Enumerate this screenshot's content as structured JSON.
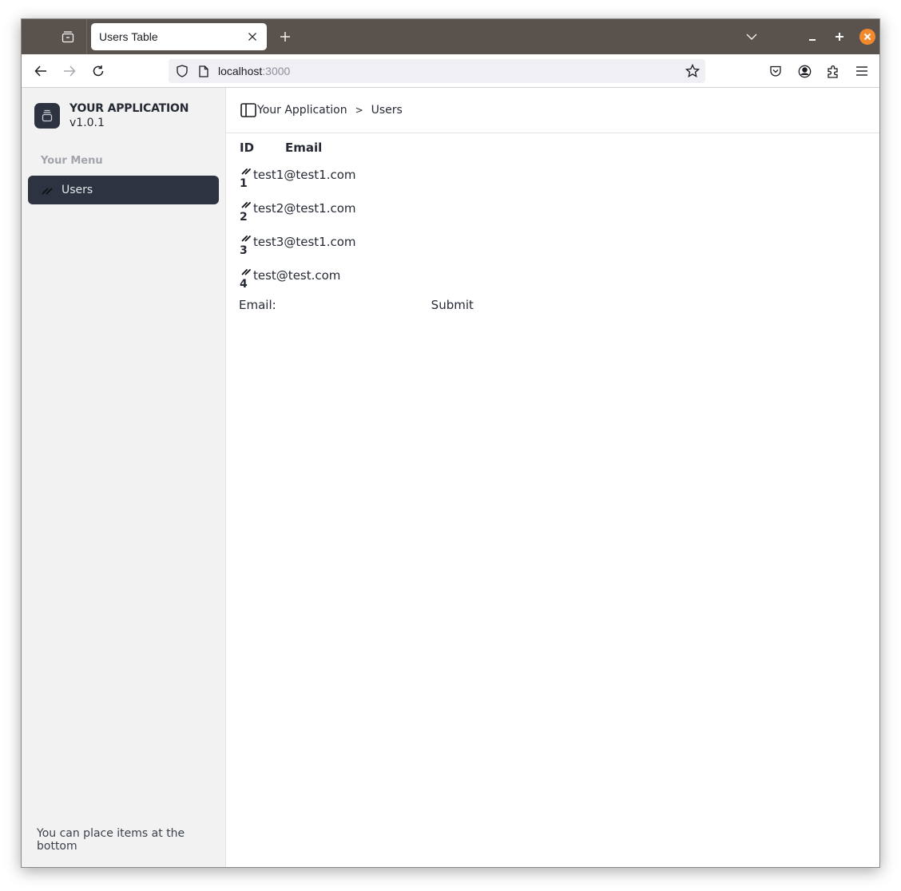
{
  "browser": {
    "tab": {
      "title": "Users Table"
    },
    "url": {
      "host": "localhost",
      "port": ":3000"
    },
    "icons": {
      "tab_list": "tab-list-icon",
      "close_tab": "close-icon",
      "new_tab": "plus-icon",
      "tabs_dropdown": "chevron-down-icon",
      "back": "arrow-left-icon",
      "forward": "arrow-right-icon",
      "reload": "reload-icon",
      "shield": "shield-icon",
      "page": "page-icon",
      "bookmark": "star-icon",
      "pocket": "pocket-icon",
      "account": "account-icon",
      "extensions": "puzzle-icon",
      "menu": "hamburger-icon"
    },
    "accent_close": "#f08a2c"
  },
  "sidebar": {
    "brand": {
      "name": "YOUR APPLICATION",
      "version": "v1.0.1"
    },
    "menu_label": "Your Menu",
    "items": [
      {
        "label": "Users",
        "icon": "slashes-icon",
        "active": true
      }
    ],
    "footer": "You can place items at the bottom"
  },
  "header": {
    "breadcrumb": [
      {
        "label": "Your Application"
      },
      {
        "label": "Users"
      }
    ],
    "separator": ">"
  },
  "table": {
    "columns": [
      "ID",
      "Email"
    ],
    "rows": [
      {
        "id": "1",
        "email": "test1@test1.com"
      },
      {
        "id": "2",
        "email": "test2@test1.com"
      },
      {
        "id": "3",
        "email": "test3@test1.com"
      },
      {
        "id": "4",
        "email": "test@test.com"
      }
    ]
  },
  "form": {
    "label": "Email:",
    "value": "",
    "submit_label": "Submit"
  },
  "colors": {
    "sidebar_bg": "#f2f2f2",
    "active_item_bg": "#2d3340",
    "titlebar_bg": "#5a524c",
    "text": "#252a35"
  }
}
